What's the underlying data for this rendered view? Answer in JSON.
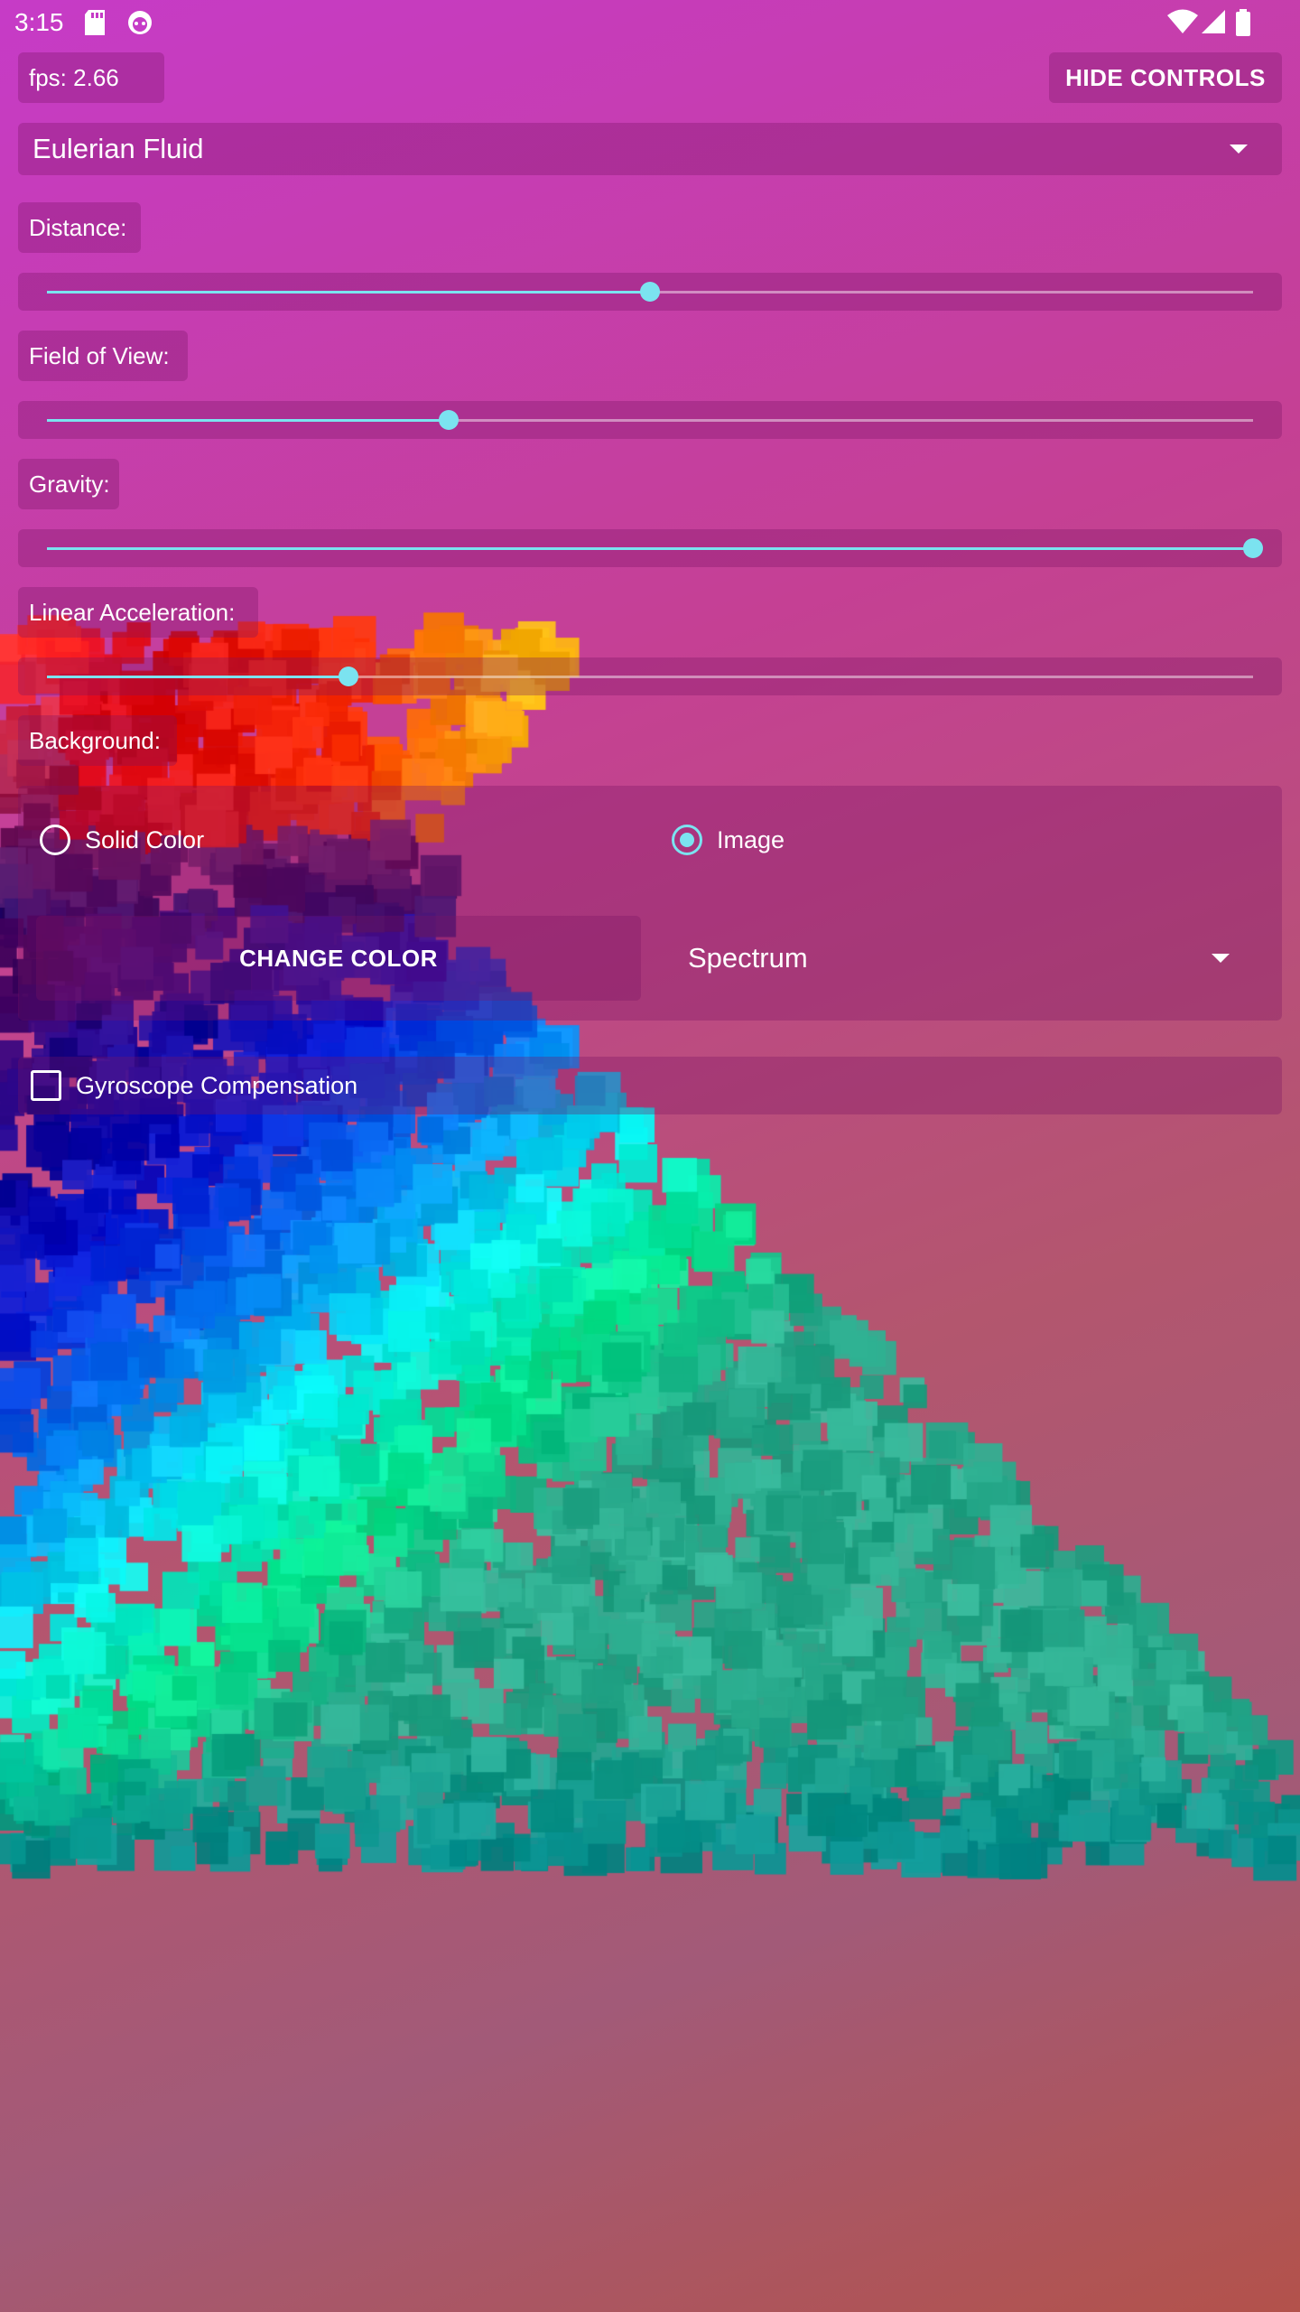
{
  "status_bar": {
    "time": "3:15",
    "left_icons": [
      "sd-card-icon",
      "android-debug-icon"
    ],
    "right_icons": [
      "wifi-icon",
      "cellular-signal-icon",
      "battery-icon"
    ]
  },
  "toolbar": {
    "fps_text": "fps: 2.66",
    "hide_controls_label": "HIDE CONTROLS"
  },
  "simulation_select": {
    "value": "Eulerian Fluid"
  },
  "sliders": {
    "distance": {
      "label": "Distance:",
      "value": 0.5
    },
    "field_of_view": {
      "label": "Field of View:",
      "value": 0.333
    },
    "gravity": {
      "label": "Gravity:",
      "value": 1.0
    },
    "linear_acceleration": {
      "label": "Linear Acceleration:",
      "value": 0.25
    }
  },
  "background": {
    "label": "Background:",
    "options": [
      {
        "label": "Solid Color",
        "selected": false
      },
      {
        "label": "Image",
        "selected": true
      }
    ],
    "change_color_label": "CHANGE COLOR",
    "image_select_value": "Spectrum"
  },
  "gyroscope": {
    "label": "Gyroscope Compensation",
    "checked": false
  },
  "colors": {
    "accent": "#7be3f0",
    "panel": "rgba(120,20,100,0.32)"
  }
}
